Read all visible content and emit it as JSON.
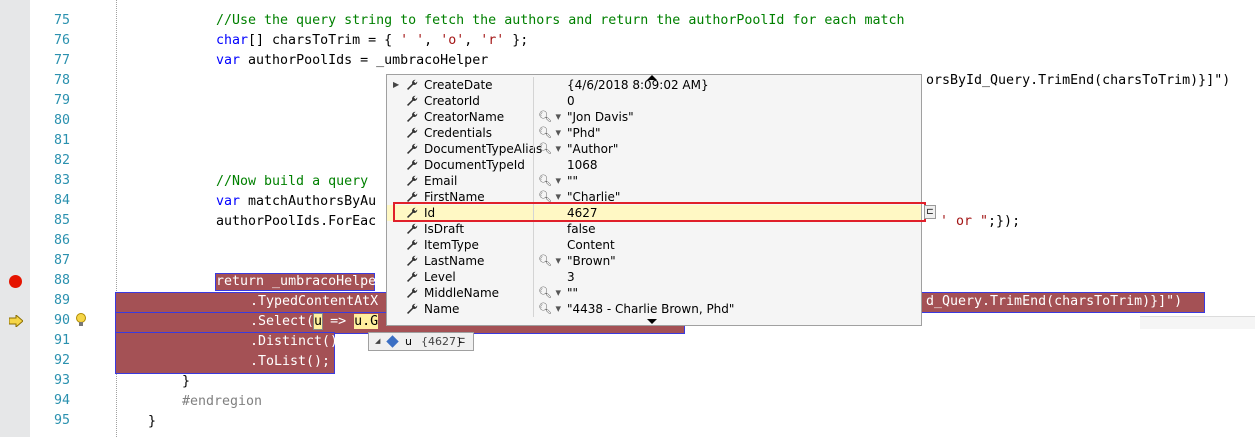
{
  "editor": {
    "line_numbers": [
      "75",
      "76",
      "77",
      "78",
      "79",
      "80",
      "81",
      "82",
      "83",
      "84",
      "85",
      "86",
      "87",
      "88",
      "89",
      "90",
      "91",
      "92",
      "93",
      "94",
      "95"
    ],
    "lines": {
      "l75": {
        "comment": "//Use the query string to fetch the authors and return the authorPoolId for each match"
      },
      "l76": {
        "kw": "char",
        "p1": "[] charsToTrim = { ",
        "s1": "' '",
        "p2": ", ",
        "s2": "'o'",
        "p3": ", ",
        "s3": "'r'",
        "p4": " };"
      },
      "l77": {
        "kw": "var",
        "p1": " authorPoolIds = _umbracoHelper"
      },
      "l78": {
        "tail": "orsById_Query.TrimEnd(charsToTrim)}]\")"
      },
      "l83": {
        "comment": "//Now build a query"
      },
      "l84": {
        "kw": "var",
        "p1": " matchAuthorsByAu"
      },
      "l85": {
        "p1": "authorPoolIds.ForEac",
        "tail_s": "' or \"",
        "tail_p": ";});"
      },
      "l88": {
        "kw": "return",
        "p1": " _umbracoHelpe"
      },
      "l89": {
        "p1": ".TypedContentAtX",
        "tail": "d_Query.TrimEnd(charsToTrim)}]\")"
      },
      "l90": {
        "p1": ".Select(",
        "p2": "u",
        "p3": " => ",
        "p4": "u.G"
      },
      "l91": {
        "p1": ".Distinct()"
      },
      "l92": {
        "p1": ".ToList();"
      },
      "l93": {
        "p1": "}"
      },
      "l94": {
        "pp": "#endregion"
      },
      "l95": {
        "p1": "}"
      }
    }
  },
  "datatip": {
    "rows": [
      {
        "name": "CreateDate",
        "value": "{4/6/2018 8:09:02 AM}",
        "expandable": true,
        "viewer": false
      },
      {
        "name": "CreatorId",
        "value": "0",
        "expandable": false,
        "viewer": false
      },
      {
        "name": "CreatorName",
        "value": "\"Jon Davis\"",
        "expandable": false,
        "viewer": true
      },
      {
        "name": "Credentials",
        "value": "\"Phd\"",
        "expandable": false,
        "viewer": true
      },
      {
        "name": "DocumentTypeAlias",
        "value": "\"Author\"",
        "expandable": false,
        "viewer": true
      },
      {
        "name": "DocumentTypeId",
        "value": "1068",
        "expandable": false,
        "viewer": false
      },
      {
        "name": "Email",
        "value": "\"\"",
        "expandable": false,
        "viewer": true
      },
      {
        "name": "FirstName",
        "value": "\"Charlie\"",
        "expandable": false,
        "viewer": true
      },
      {
        "name": "Id",
        "value": "4627",
        "expandable": false,
        "viewer": false,
        "highlighted": true
      },
      {
        "name": "IsDraft",
        "value": "false",
        "expandable": false,
        "viewer": false
      },
      {
        "name": "ItemType",
        "value": "Content",
        "expandable": false,
        "viewer": false
      },
      {
        "name": "LastName",
        "value": "\"Brown\"",
        "expandable": false,
        "viewer": true
      },
      {
        "name": "Level",
        "value": "3",
        "expandable": false,
        "viewer": false
      },
      {
        "name": "MiddleName",
        "value": "\"\"",
        "expandable": false,
        "viewer": true
      },
      {
        "name": "Name",
        "value": "\"4438 -  Charlie Brown, Phd\"",
        "expandable": false,
        "viewer": true
      }
    ]
  },
  "small_tip": {
    "var": "u",
    "value": "{4627}"
  },
  "colors": {
    "highlight": "#a45155",
    "breakpoint": "#e51400",
    "red_box": "#e0202a",
    "line_number": "#2b91af",
    "keyword": "#0000ff",
    "comment": "#008000",
    "string": "#a31515"
  }
}
